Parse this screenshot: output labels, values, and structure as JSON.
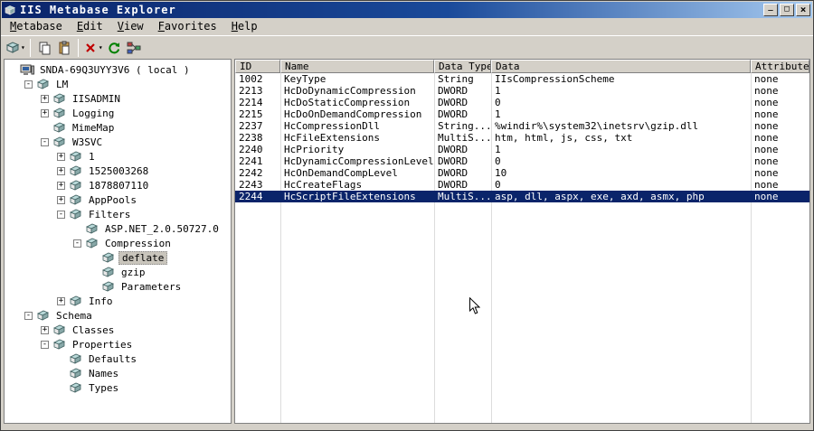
{
  "title_bar": {
    "title": "IIS Metabase Explorer",
    "controls": {
      "minimize": "_",
      "maximize": "□",
      "close": "×"
    }
  },
  "menu": {
    "items": [
      {
        "label": "Metabase"
      },
      {
        "label": "Edit"
      },
      {
        "label": "View"
      },
      {
        "label": "Favorites"
      },
      {
        "label": "Help"
      }
    ]
  },
  "toolbar": {
    "buttons": [
      {
        "name": "connect-button",
        "icon": "connect-icon",
        "dropdown": true
      },
      {
        "separator": true
      },
      {
        "name": "copy-button",
        "icon": "copy-icon"
      },
      {
        "name": "paste-button",
        "icon": "paste-icon"
      },
      {
        "separator": true
      },
      {
        "name": "delete-button",
        "icon": "delete-icon",
        "dropdown": true
      },
      {
        "name": "refresh-button",
        "icon": "refresh-icon"
      },
      {
        "name": "network-button",
        "icon": "network-icon"
      }
    ]
  },
  "tree": {
    "items": [
      {
        "label": "SNDA-69Q3UYY3V6 ( local )",
        "level": 0,
        "expand": "none",
        "icon": "computer",
        "selected": false
      },
      {
        "label": "LM",
        "level": 1,
        "expand": "minus",
        "icon": "key",
        "selected": false
      },
      {
        "label": "IISADMIN",
        "level": 2,
        "expand": "plus",
        "icon": "key",
        "selected": false
      },
      {
        "label": "Logging",
        "level": 2,
        "expand": "plus",
        "icon": "key",
        "selected": false
      },
      {
        "label": "MimeMap",
        "level": 2,
        "expand": "none",
        "icon": "key",
        "selected": false
      },
      {
        "label": "W3SVC",
        "level": 2,
        "expand": "minus",
        "icon": "key",
        "selected": false
      },
      {
        "label": "1",
        "level": 3,
        "expand": "plus",
        "icon": "key",
        "selected": false
      },
      {
        "label": "1525003268",
        "level": 3,
        "expand": "plus",
        "icon": "key",
        "selected": false
      },
      {
        "label": "1878807110",
        "level": 3,
        "expand": "plus",
        "icon": "key",
        "selected": false
      },
      {
        "label": "AppPools",
        "level": 3,
        "expand": "plus",
        "icon": "key",
        "selected": false
      },
      {
        "label": "Filters",
        "level": 3,
        "expand": "minus",
        "icon": "key",
        "selected": false
      },
      {
        "label": "ASP.NET_2.0.50727.0",
        "level": 4,
        "expand": "none",
        "icon": "key",
        "selected": false
      },
      {
        "label": "Compression",
        "level": 4,
        "expand": "minus",
        "icon": "key",
        "selected": false
      },
      {
        "label": "deflate",
        "level": 5,
        "expand": "none",
        "icon": "key",
        "selected": true
      },
      {
        "label": "gzip",
        "level": 5,
        "expand": "none",
        "icon": "key",
        "selected": false
      },
      {
        "label": "Parameters",
        "level": 5,
        "expand": "none",
        "icon": "key",
        "selected": false
      },
      {
        "label": "Info",
        "level": 3,
        "expand": "plus",
        "icon": "key",
        "selected": false
      },
      {
        "label": "Schema",
        "level": 1,
        "expand": "minus",
        "icon": "key",
        "selected": false
      },
      {
        "label": "Classes",
        "level": 2,
        "expand": "plus",
        "icon": "key",
        "selected": false
      },
      {
        "label": "Properties",
        "level": 2,
        "expand": "minus",
        "icon": "key",
        "selected": false
      },
      {
        "label": "Defaults",
        "level": 3,
        "expand": "none",
        "icon": "key",
        "selected": false
      },
      {
        "label": "Names",
        "level": 3,
        "expand": "none",
        "icon": "key",
        "selected": false
      },
      {
        "label": "Types",
        "level": 3,
        "expand": "none",
        "icon": "key",
        "selected": false
      }
    ]
  },
  "table": {
    "columns": [
      "ID",
      "Name",
      "Data Type",
      "Data",
      "Attributes"
    ],
    "rows": [
      {
        "id": "1002",
        "name": "KeyType",
        "type": "String",
        "data": "IIsCompressionScheme",
        "attributes": "none",
        "selected": false
      },
      {
        "id": "2213",
        "name": "HcDoDynamicCompression",
        "type": "DWORD",
        "data": "1",
        "attributes": "none",
        "selected": false
      },
      {
        "id": "2214",
        "name": "HcDoStaticCompression",
        "type": "DWORD",
        "data": "0",
        "attributes": "none",
        "selected": false
      },
      {
        "id": "2215",
        "name": "HcDoOnDemandCompression",
        "type": "DWORD",
        "data": "1",
        "attributes": "none",
        "selected": false
      },
      {
        "id": "2237",
        "name": "HcCompressionDll",
        "type": "String...",
        "data": "%windir%\\system32\\inetsrv\\gzip.dll",
        "attributes": "none",
        "selected": false
      },
      {
        "id": "2238",
        "name": "HcFileExtensions",
        "type": "MultiS...",
        "data": "htm, html, js, css, txt",
        "attributes": "none",
        "selected": false
      },
      {
        "id": "2240",
        "name": "HcPriority",
        "type": "DWORD",
        "data": "1",
        "attributes": "none",
        "selected": false
      },
      {
        "id": "2241",
        "name": "HcDynamicCompressionLevel",
        "type": "DWORD",
        "data": "0",
        "attributes": "none",
        "selected": false
      },
      {
        "id": "2242",
        "name": "HcOnDemandCompLevel",
        "type": "DWORD",
        "data": "10",
        "attributes": "none",
        "selected": false
      },
      {
        "id": "2243",
        "name": "HcCreateFlags",
        "type": "DWORD",
        "data": "0",
        "attributes": "none",
        "selected": false
      },
      {
        "id": "2244",
        "name": "HcScriptFileExtensions",
        "type": "MultiS...",
        "data": "asp, dll, aspx, exe, axd, asmx, php",
        "attributes": "none",
        "selected": true
      }
    ]
  }
}
